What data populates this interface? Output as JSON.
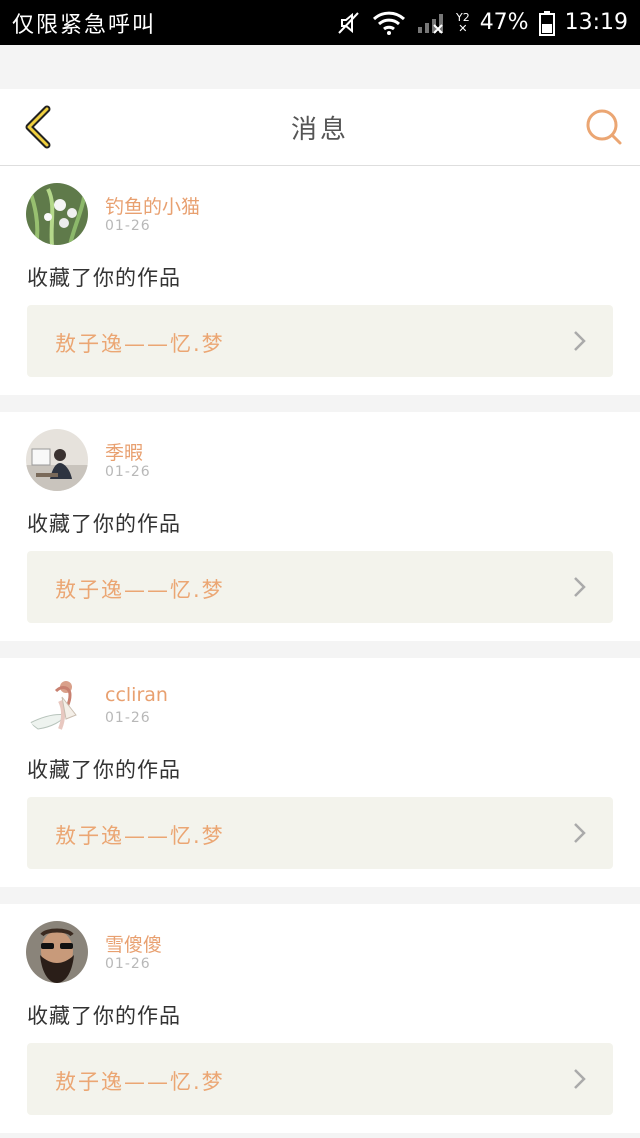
{
  "status_bar": {
    "carrier": "仅限紧急呼叫",
    "signal_label": "Y2",
    "battery": "47%",
    "time": "13:19"
  },
  "header": {
    "title": "消息"
  },
  "messages": [
    {
      "username": "钓鱼的小猫",
      "date": "01-26",
      "action": "收藏了你的作品",
      "work": "敖子逸——忆.梦"
    },
    {
      "username": "季暇",
      "date": "01-26",
      "action": "收藏了你的作品",
      "work": "敖子逸——忆.梦"
    },
    {
      "username": "ccliran",
      "date": "01-26",
      "action": "收藏了你的作品",
      "work": "敖子逸——忆.梦"
    },
    {
      "username": "雪傻傻",
      "date": "01-26",
      "action": "收藏了你的作品",
      "work": "敖子逸——忆.梦"
    }
  ],
  "colors": {
    "accent": "#e8a070",
    "back_icon": "#e6c23a",
    "work_bg": "#f3f3ec"
  }
}
